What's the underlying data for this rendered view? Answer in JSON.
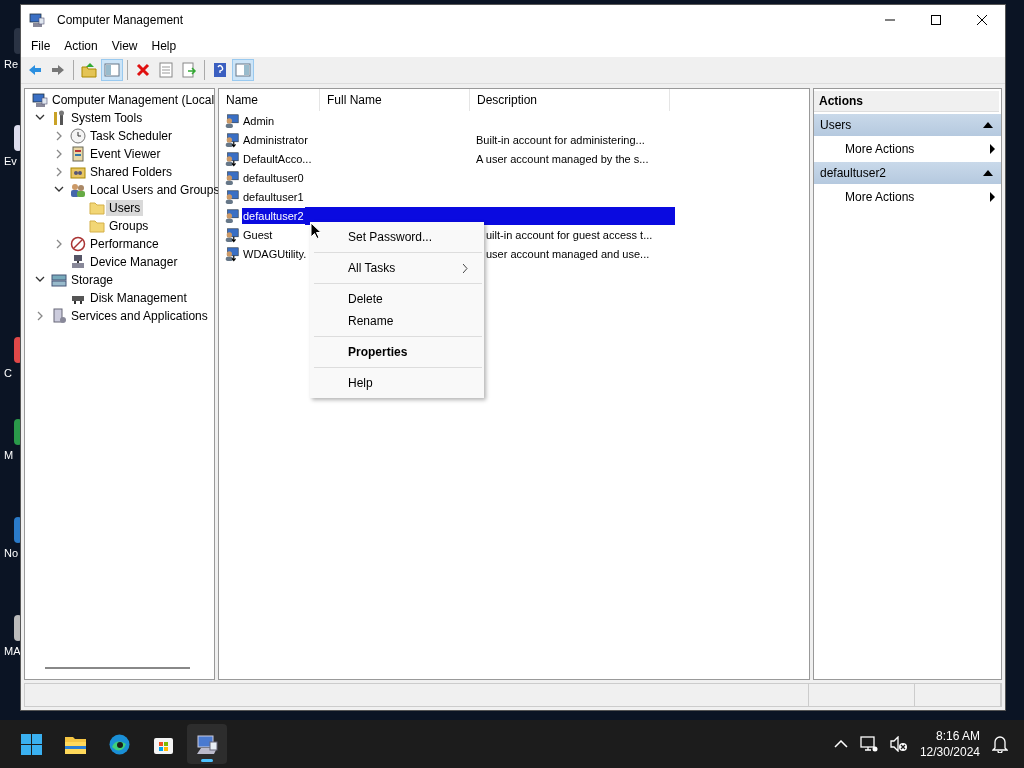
{
  "desktop_icons": [
    {
      "label": "Re"
    },
    {
      "label": "Ev"
    },
    {
      "label": "C"
    },
    {
      "label": "M"
    },
    {
      "label": "No"
    },
    {
      "label": "MA"
    }
  ],
  "window": {
    "title": "Computer Management"
  },
  "menu": [
    "File",
    "Action",
    "View",
    "Help"
  ],
  "toolbar": [
    {
      "kind": "back"
    },
    {
      "kind": "forward"
    },
    {
      "kind": "separator"
    },
    {
      "kind": "up",
      "pressed": false
    },
    {
      "kind": "tree",
      "pressed": true
    },
    {
      "kind": "separator"
    },
    {
      "kind": "delete"
    },
    {
      "kind": "properties"
    },
    {
      "kind": "export"
    },
    {
      "kind": "separator"
    },
    {
      "kind": "help"
    },
    {
      "kind": "actionpane",
      "pressed": true
    }
  ],
  "tree": {
    "label": "Computer Management (Local",
    "kind": "computer",
    "selected": false,
    "children": [
      {
        "label": "System Tools",
        "kind": "tools",
        "expanded": true,
        "selected": false,
        "children": [
          {
            "label": "Task Scheduler",
            "kind": "clock",
            "expanded": false,
            "selected": false
          },
          {
            "label": "Event Viewer",
            "kind": "log",
            "expanded": false,
            "selected": false
          },
          {
            "label": "Shared Folders",
            "kind": "share",
            "expanded": false,
            "selected": false
          },
          {
            "label": "Local Users and Groups",
            "kind": "users",
            "expanded": true,
            "selected": false,
            "children": [
              {
                "label": "Users",
                "kind": "folder",
                "selected": true
              },
              {
                "label": "Groups",
                "kind": "folder",
                "selected": false
              }
            ]
          },
          {
            "label": "Performance",
            "kind": "perf",
            "expanded": false,
            "selected": false
          },
          {
            "label": "Device Manager",
            "kind": "device",
            "selected": false
          }
        ]
      },
      {
        "label": "Storage",
        "kind": "storage",
        "expanded": true,
        "selected": false,
        "children": [
          {
            "label": "Disk Management",
            "kind": "disk",
            "selected": false
          }
        ]
      },
      {
        "label": "Services and Applications",
        "kind": "services",
        "expanded": false,
        "selected": false
      }
    ]
  },
  "list": {
    "columns": [
      "Name",
      "Full Name",
      "Description"
    ],
    "rows": [
      {
        "name": "Admin",
        "disabled": false,
        "selected": false
      },
      {
        "name": "Administrator",
        "description": "Built-in account for administering...",
        "disabled": true,
        "selected": false
      },
      {
        "name": "DefaultAcco...",
        "description": "A user account managed by the s...",
        "disabled": true,
        "selected": false
      },
      {
        "name": "defaultuser0",
        "disabled": false,
        "selected": false
      },
      {
        "name": "defaultuser1",
        "disabled": false,
        "selected": false
      },
      {
        "name": "defaultuser2",
        "disabled": false,
        "selected": true
      },
      {
        "name": "Guest",
        "description": "uilt-in account for guest access t...",
        "disabled": true,
        "selected": false
      },
      {
        "name": "WDAGUtility.",
        "description": "user account managed and use...",
        "disabled": true,
        "selected": false
      }
    ]
  },
  "actions": {
    "title": "Actions",
    "sections": [
      {
        "title": "Users",
        "expanded": true,
        "items": [
          "More Actions"
        ]
      },
      {
        "title": "defaultuser2",
        "expanded": true,
        "items": [
          "More Actions"
        ]
      }
    ]
  },
  "context_menu": {
    "groups": [
      [
        {
          "label": "Set Password...",
          "submenu": false,
          "default": false
        }
      ],
      [
        {
          "label": "All Tasks",
          "submenu": true,
          "default": false
        }
      ],
      [
        {
          "label": "Delete",
          "submenu": false,
          "default": false
        },
        {
          "label": "Rename",
          "submenu": false,
          "default": false
        }
      ],
      [
        {
          "label": "Properties",
          "submenu": false,
          "default": true
        }
      ],
      [
        {
          "label": "Help",
          "submenu": false,
          "default": false
        }
      ]
    ]
  },
  "taskbar": {
    "apps": [
      {
        "kind": "start",
        "active": false
      },
      {
        "kind": "explorer",
        "active": false
      },
      {
        "kind": "edge",
        "active": false
      },
      {
        "kind": "store",
        "active": false
      },
      {
        "kind": "compmgmt",
        "active": true
      }
    ],
    "time": "8:16 AM",
    "date": "12/30/2024"
  }
}
